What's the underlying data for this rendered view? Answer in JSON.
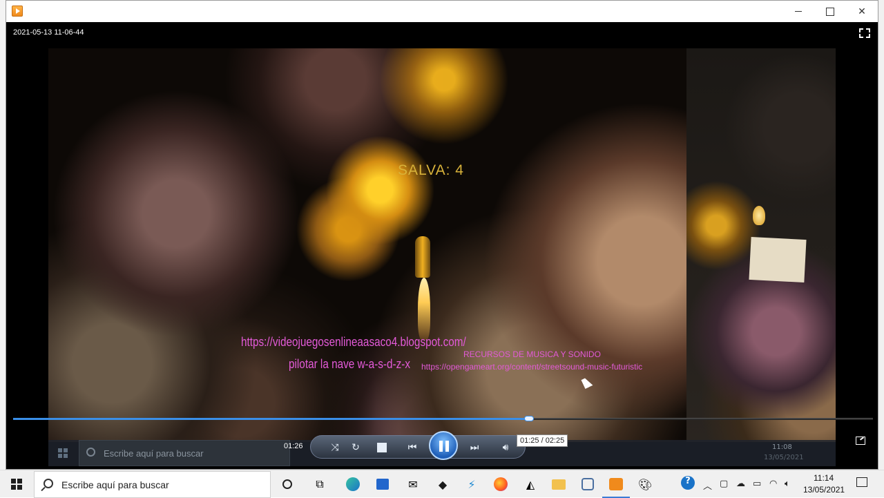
{
  "window": {
    "timestamp": "2021-05-13 11-06-44",
    "icons": {
      "app": "media-player-icon",
      "minimize": "minimize-icon",
      "maximize": "maximize-icon",
      "close": "close-icon",
      "fullscreen": "fullscreen-toggle-icon"
    }
  },
  "video": {
    "hud_score": "SALVA: 4",
    "blog_link": "https://videojuegosenlineaasaco4.blogspot.com/",
    "controls_hint": "pilotar la nave w-a-s-d-z-x",
    "credits_title": "RECURSOS DE MUSICA Y SONIDO",
    "credits_url": "https://opengameart.org/content/streetsound-music-futuristic",
    "embedded_taskbar": {
      "search_placeholder": "Escribe aquí para buscar",
      "time": "11:08",
      "date": "13/05/2021"
    }
  },
  "player": {
    "elapsed": "01:26",
    "tooltip": "01:25 / 02:25",
    "progress": 0.6,
    "accent_color": "#3a8fe8",
    "controls": [
      "shuffle-icon",
      "repeat-icon",
      "stop-icon",
      "previous-icon",
      "pause-icon",
      "next-icon",
      "volume-icon"
    ]
  },
  "taskbar": {
    "search_placeholder": "Escribe aquí para buscar",
    "time": "11:14",
    "date": "13/05/2021",
    "apps": [
      "cortana-icon",
      "task-view-icon",
      "edge-icon",
      "store-icon",
      "mail-icon",
      "dropbox-icon",
      "visual-studio-code-icon",
      "firefox-icon",
      "unity-icon",
      "file-explorer-icon",
      "app-icon",
      "media-player-icon",
      "paint-icon"
    ]
  }
}
